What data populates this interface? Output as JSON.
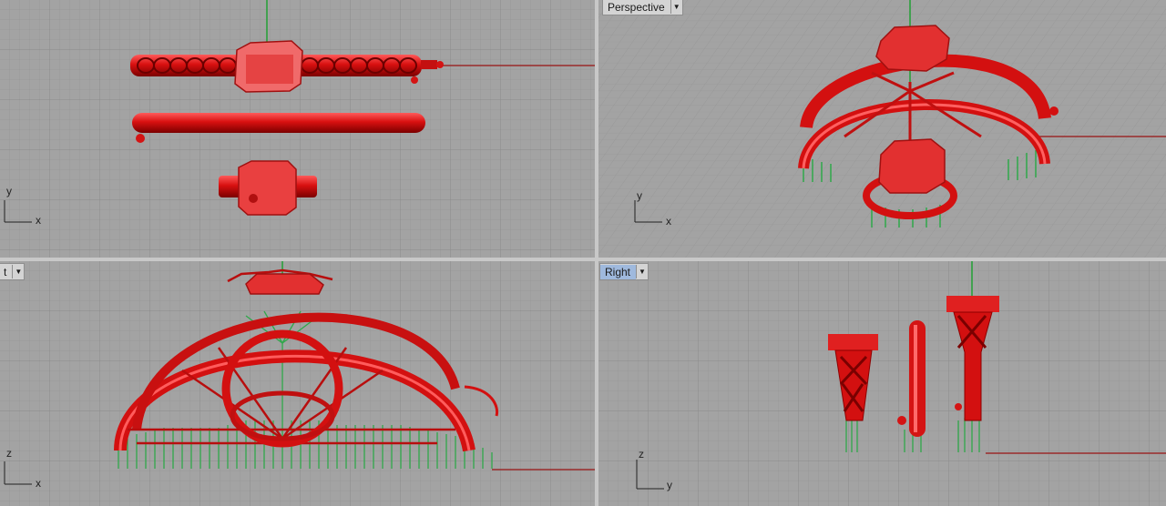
{
  "viewports": {
    "top": {
      "label": "",
      "axis_h": "x",
      "axis_v": "y"
    },
    "perspective": {
      "label": "Perspective",
      "axis_h": "x",
      "axis_v": "y"
    },
    "front": {
      "label": "t",
      "axis_h": "x",
      "axis_v": "z"
    },
    "right": {
      "label": "Right",
      "axis_h": "y",
      "axis_v": "z"
    }
  },
  "colors": {
    "model": "#dd1010",
    "model_dark": "#8e0000",
    "supports": "#2fa84a",
    "grid_bg": "#a3a3a3",
    "grid_line": "#9a9a9a",
    "grid_major": "#8c8c8c",
    "axis_x": "#9a2a2a",
    "axis_y": "#22a035"
  },
  "icons": {
    "viewport_menu": "chevron-down-icon"
  }
}
